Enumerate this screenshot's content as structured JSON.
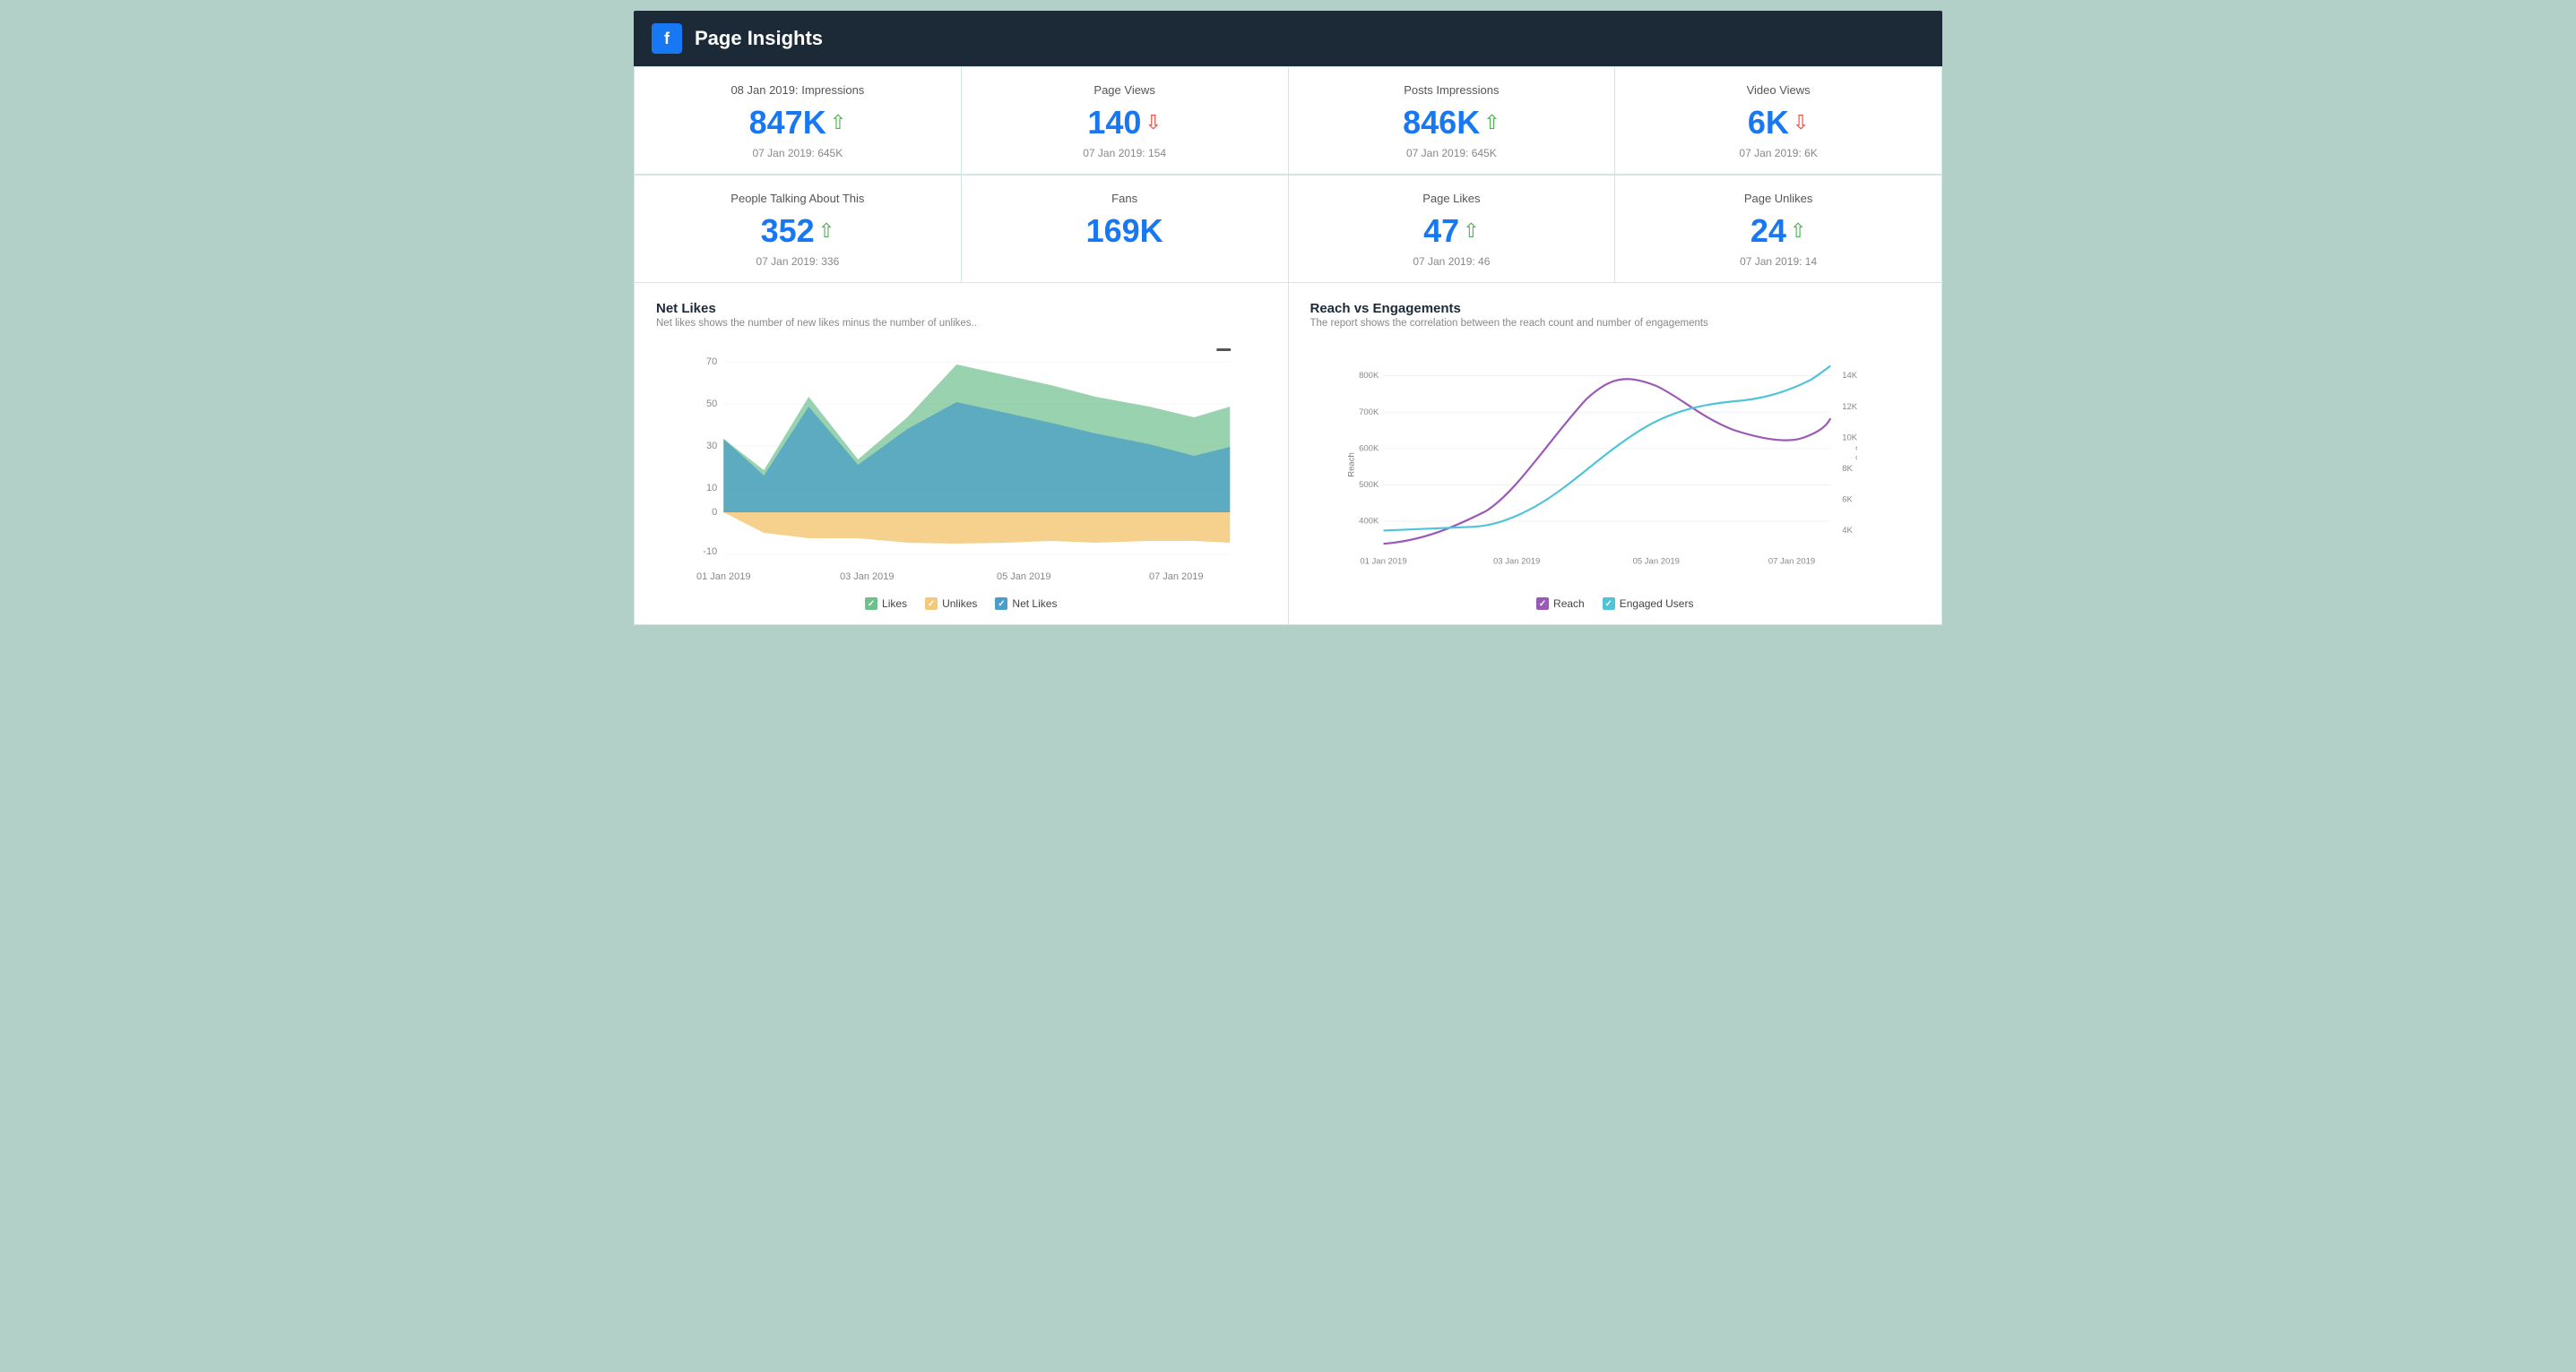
{
  "header": {
    "title": "Page Insights",
    "fb_label": "f"
  },
  "metrics_row1": [
    {
      "label": "08 Jan 2019: Impressions",
      "value": "847K",
      "trend": "up",
      "prev": "07 Jan 2019: 645K"
    },
    {
      "label": "Page Views",
      "value": "140",
      "trend": "down",
      "prev": "07 Jan 2019: 154"
    },
    {
      "label": "Posts Impressions",
      "value": "846K",
      "trend": "up",
      "prev": "07 Jan 2019: 645K"
    },
    {
      "label": "Video Views",
      "value": "6K",
      "trend": "down",
      "prev": "07 Jan 2019: 6K"
    }
  ],
  "metrics_row2": [
    {
      "label": "People Talking About This",
      "value": "352",
      "trend": "up",
      "prev": "07 Jan 2019: 336"
    },
    {
      "label": "Fans",
      "value": "169K",
      "trend": "none",
      "prev": ""
    },
    {
      "label": "Page Likes",
      "value": "47",
      "trend": "up",
      "prev": "07 Jan 2019: 46"
    },
    {
      "label": "Page Unlikes",
      "value": "24",
      "trend": "up",
      "prev": "07 Jan 2019: 14"
    }
  ],
  "net_likes_chart": {
    "title": "Net Likes",
    "subtitle": "Net likes shows the number of new likes minus the number of unlikes..",
    "legend": [
      {
        "label": "Likes",
        "color": "#6dbf8b"
      },
      {
        "label": "Unlikes",
        "color": "#f5c97a"
      },
      {
        "label": "Net Likes",
        "color": "#4a9ec7"
      }
    ],
    "x_labels": [
      "01 Jan 2019",
      "03 Jan 2019",
      "05 Jan 2019",
      "07 Jan 2019"
    ],
    "y_labels": [
      "70",
      "50",
      "30",
      "10",
      "0",
      "-10"
    ]
  },
  "reach_chart": {
    "title": "Reach vs Engagements",
    "subtitle": "The report shows the correlation between the reach count and number of engagements",
    "legend": [
      {
        "label": "Reach",
        "color": "#9b59b6"
      },
      {
        "label": "Engaged Users",
        "color": "#4fc3d8"
      }
    ],
    "x_labels": [
      "01 Jan 2019",
      "03 Jan 2019",
      "05 Jan 2019",
      "07 Jan 2019"
    ],
    "y_labels_left": [
      "800K",
      "700K",
      "600K",
      "500K",
      "400K"
    ],
    "y_labels_right": [
      "14K",
      "12K",
      "10K",
      "8K",
      "6K",
      "4K"
    ],
    "left_axis_label": "Reach",
    "right_axis_label": "Engaged Users"
  }
}
